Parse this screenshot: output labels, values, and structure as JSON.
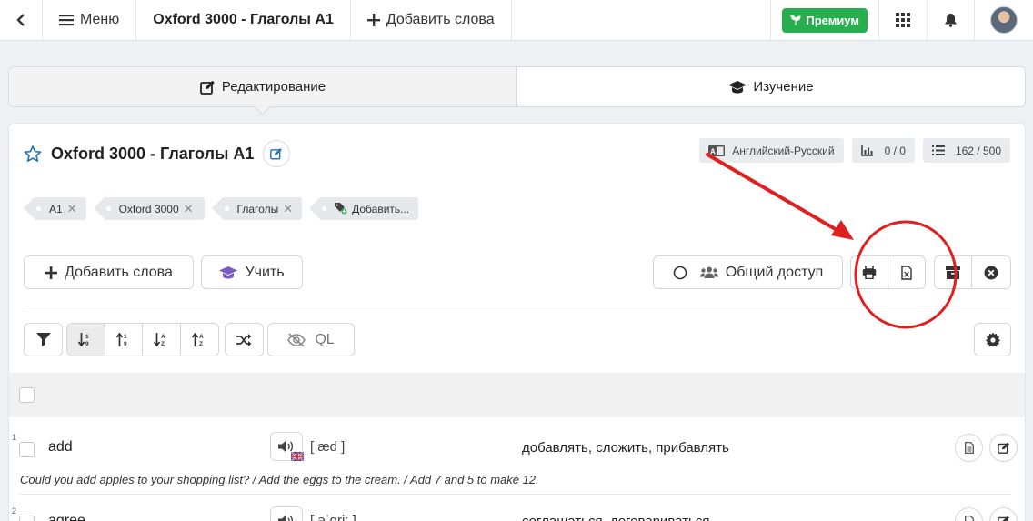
{
  "nav": {
    "menu_label": "Меню",
    "title": "Oxford 3000 - Глаголы A1",
    "add_words_label": "Добавить слова",
    "premium_label": "Премиум"
  },
  "mode_tabs": [
    {
      "label": "Редактирование",
      "active": true
    },
    {
      "label": "Изучение",
      "active": false
    }
  ],
  "set": {
    "title": "Oxford 3000 - Глаголы A1",
    "language_pair": "Английский-Русский",
    "progress": "0 / 0",
    "word_count": "162 / 500",
    "tags": [
      {
        "label": "A1"
      },
      {
        "label": "Oxford 3000"
      },
      {
        "label": "Глаголы"
      }
    ],
    "add_tag_label": "Добавить..."
  },
  "actions": {
    "add_words_label": "Добавить слова",
    "learn_label": "Учить",
    "share_label": "Общий доступ",
    "ql_label": "QL"
  },
  "rows": [
    {
      "index": "1",
      "word": "add",
      "transcription": "[ æd ]",
      "translation": "добавлять, сложить, прибавлять",
      "example": "Could you add apples to your shopping list? / Add the eggs to the cream. / Add 7 and 5 to make 12."
    },
    {
      "index": "2",
      "word": "agree",
      "transcription": "[ əˈɡriː ]",
      "translation": "соглашаться, договариваться",
      "example": ""
    }
  ],
  "colors": {
    "accent_blue": "#2a7ab8",
    "premium_green": "#27ae4f",
    "learn_purple": "#7b5cc4",
    "annotation_red": "#e02020"
  }
}
